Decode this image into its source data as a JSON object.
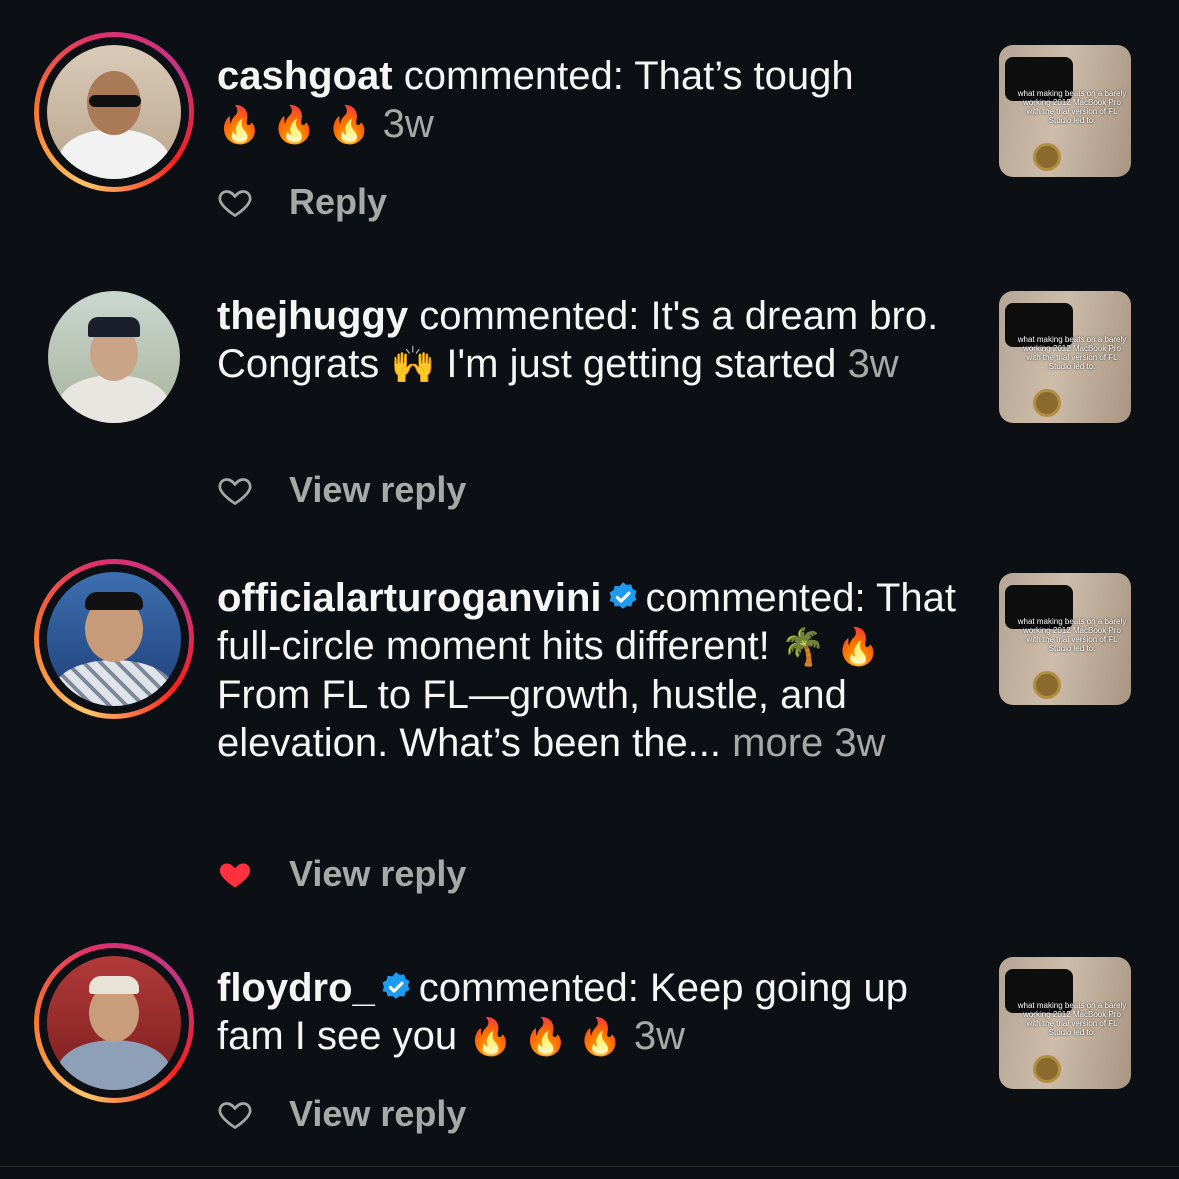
{
  "colors": {
    "background": "#0c1014",
    "muted": "#a8a8a8",
    "liked": "#ff3040",
    "verified": "#1d9bf0"
  },
  "thumbnail_caption": "what making beats on a barely working 2012 MacBook Pro with the trial version of FL Studio led to:",
  "comments": [
    {
      "username": "cashgoat",
      "verified": false,
      "verb": "commented:",
      "text": "That’s tough",
      "emoji": "🔥 🔥 🔥",
      "time": "3w",
      "reply_label": "Reply",
      "liked": false
    },
    {
      "username": "thejhuggy",
      "verified": false,
      "verb": "commented:",
      "text_a": "It's a dream bro. Congrats",
      "emoji": "🙌",
      "text_b": "I'm just getting started",
      "time": "3w",
      "reply_label": "View reply",
      "liked": false
    },
    {
      "username": "officialarturoganvini",
      "verified": true,
      "verb": "commented:",
      "text_a": "That full-circle moment hits different!",
      "emoji": "🌴 🔥",
      "text_b": "From FL to FL—growth, hustle, and elevation. What’s been the...",
      "more": "more",
      "time": "3w",
      "reply_label": "View reply",
      "liked": true
    },
    {
      "username": "floydro_",
      "verified": true,
      "verb": "commented:",
      "text": "Keep going up fam I see you",
      "emoji": "🔥 🔥 🔥",
      "time": "3w",
      "reply_label": "View reply",
      "liked": false
    }
  ]
}
